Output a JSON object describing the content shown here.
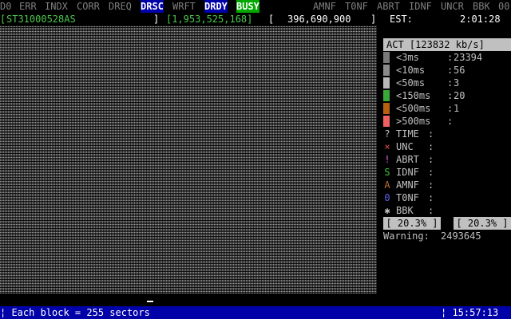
{
  "flags": [
    {
      "label": "D0",
      "state": "off"
    },
    {
      "label": "ERR",
      "state": "off"
    },
    {
      "label": "INDX",
      "state": "off"
    },
    {
      "label": "CORR",
      "state": "off"
    },
    {
      "label": "DREQ",
      "state": "off"
    },
    {
      "label": "DRSC",
      "state": "on-blue"
    },
    {
      "label": "WRFT",
      "state": "off"
    },
    {
      "label": "DRDY",
      "state": "on-blue"
    },
    {
      "label": "BUSY",
      "state": "on-green"
    },
    {
      "label": "AMNF",
      "state": "off"
    },
    {
      "label": "T0NF",
      "state": "off"
    },
    {
      "label": "ABRT",
      "state": "off"
    },
    {
      "label": "IDNF",
      "state": "off"
    },
    {
      "label": "UNCR",
      "state": "off"
    },
    {
      "label": "BBK",
      "state": "off"
    },
    {
      "label": "00",
      "state": "off"
    }
  ],
  "drive": {
    "model_open": "[",
    "model": "ST31000528AS",
    "model_close": "]",
    "lba_total": "[1,953,525,168]",
    "pos_open": "[",
    "lba_current": "396,690,900",
    "pos_close": "]",
    "est_label": "EST:",
    "est_time": "2:01:28",
    "est_close": "]"
  },
  "act": {
    "label": "ACT",
    "rate": "[123832 kb/s]"
  },
  "timings": [
    {
      "label": "<3ms",
      "sep": ":",
      "value": "23394",
      "color": "#787878"
    },
    {
      "label": "<10ms",
      "sep": ":",
      "value": "56",
      "color": "#8a8a8a"
    },
    {
      "label": "<50ms",
      "sep": ":",
      "value": "3",
      "color": "#b8b8b8"
    },
    {
      "label": "<150ms",
      "sep": ":",
      "value": "20",
      "color": "#38a838"
    },
    {
      "label": "<500ms",
      "sep": ":",
      "value": "1",
      "color": "#b86010"
    },
    {
      "label": ">500ms",
      "sep": ":",
      "value": "",
      "color": "#f06060"
    }
  ],
  "errors": [
    {
      "icon": "?",
      "label": "TIME",
      "sep": ":",
      "icon_color": "#c0c0c0",
      "icon_name": "question-icon"
    },
    {
      "icon": "×",
      "label": "UNC",
      "sep": ":",
      "icon_color": "#e05050",
      "icon_name": "cross-icon"
    },
    {
      "icon": "!",
      "label": "ABRT",
      "sep": ":",
      "icon_color": "#e060e0",
      "icon_name": "exclamation-icon"
    },
    {
      "icon": "S",
      "label": "IDNF",
      "sep": ":",
      "icon_color": "#40c040",
      "icon_name": "s-icon"
    },
    {
      "icon": "A",
      "label": "AMNF",
      "sep": ":",
      "icon_color": "#c07030",
      "icon_name": "a-icon"
    },
    {
      "icon": "0",
      "label": "T0NF",
      "sep": ":",
      "icon_color": "#6060f0",
      "icon_name": "zero-icon"
    },
    {
      "icon": "✱",
      "label": "BBK",
      "sep": ":",
      "icon_color": "#c0c0c0",
      "icon_name": "asterisk-icon"
    }
  ],
  "progress": {
    "left": "[ 20.3% ]",
    "right": "[ 20.3% ]",
    "percent": 20.3
  },
  "warning": {
    "label": "Warning:",
    "value": "2493645"
  },
  "status": {
    "left": "¦ Each block = 255 sectors",
    "right": "¦ 15:57:13"
  },
  "colors": {
    "accent_blue": "#0000a8",
    "accent_green": "#00a800",
    "drive_text": "#4cc84c"
  }
}
